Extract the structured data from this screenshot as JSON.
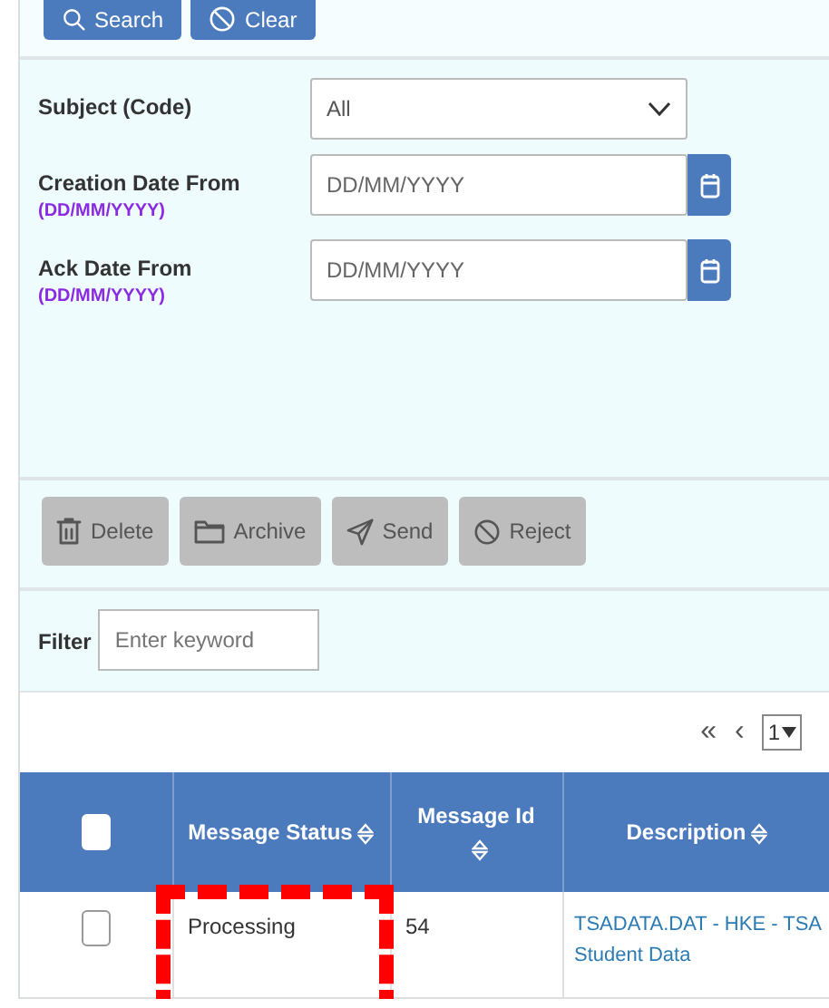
{
  "search_buttons": [
    {
      "label": "Search"
    },
    {
      "label": "Clear"
    }
  ],
  "form": {
    "fields": [
      {
        "kind": "select",
        "label": "Subject (Code)",
        "value": "All"
      },
      {
        "kind": "date",
        "label": "Creation Date From",
        "hint": "(DD/MM/YYYY)",
        "placeholder": "DD/MM/YYYY"
      },
      {
        "kind": "date",
        "label": "Ack Date From",
        "hint": "(DD/MM/YYYY)",
        "placeholder": "DD/MM/YYYY"
      }
    ]
  },
  "actions": [
    {
      "label": "Delete",
      "disabled": true
    },
    {
      "label": "Archive",
      "disabled": true
    },
    {
      "label": "Send",
      "disabled": true
    },
    {
      "label": "Reject",
      "disabled": true
    }
  ],
  "filter": {
    "label": "Filter",
    "placeholder": "Enter keyword"
  },
  "pagination": {
    "first": "«",
    "prev": "‹",
    "page": "1"
  },
  "table": {
    "columns": [
      {
        "kind": "checkbox",
        "checked": false
      },
      {
        "kind": "text",
        "label": "Message Status",
        "sortable": true
      },
      {
        "kind": "text",
        "label": "Message Id",
        "sortable": true
      },
      {
        "kind": "text",
        "label": "Description",
        "sortable": true
      }
    ],
    "rows": [
      {
        "cells": [
          {
            "kind": "checkbox",
            "checked": false
          },
          {
            "kind": "text",
            "text": "Processing",
            "highlighted": true
          },
          {
            "kind": "text",
            "text": "54",
            "highlighted": false
          },
          {
            "kind": "link",
            "text": "TSADATA.DAT - HKE - TSA Student Data",
            "highlighted": false
          }
        ]
      }
    ]
  }
}
